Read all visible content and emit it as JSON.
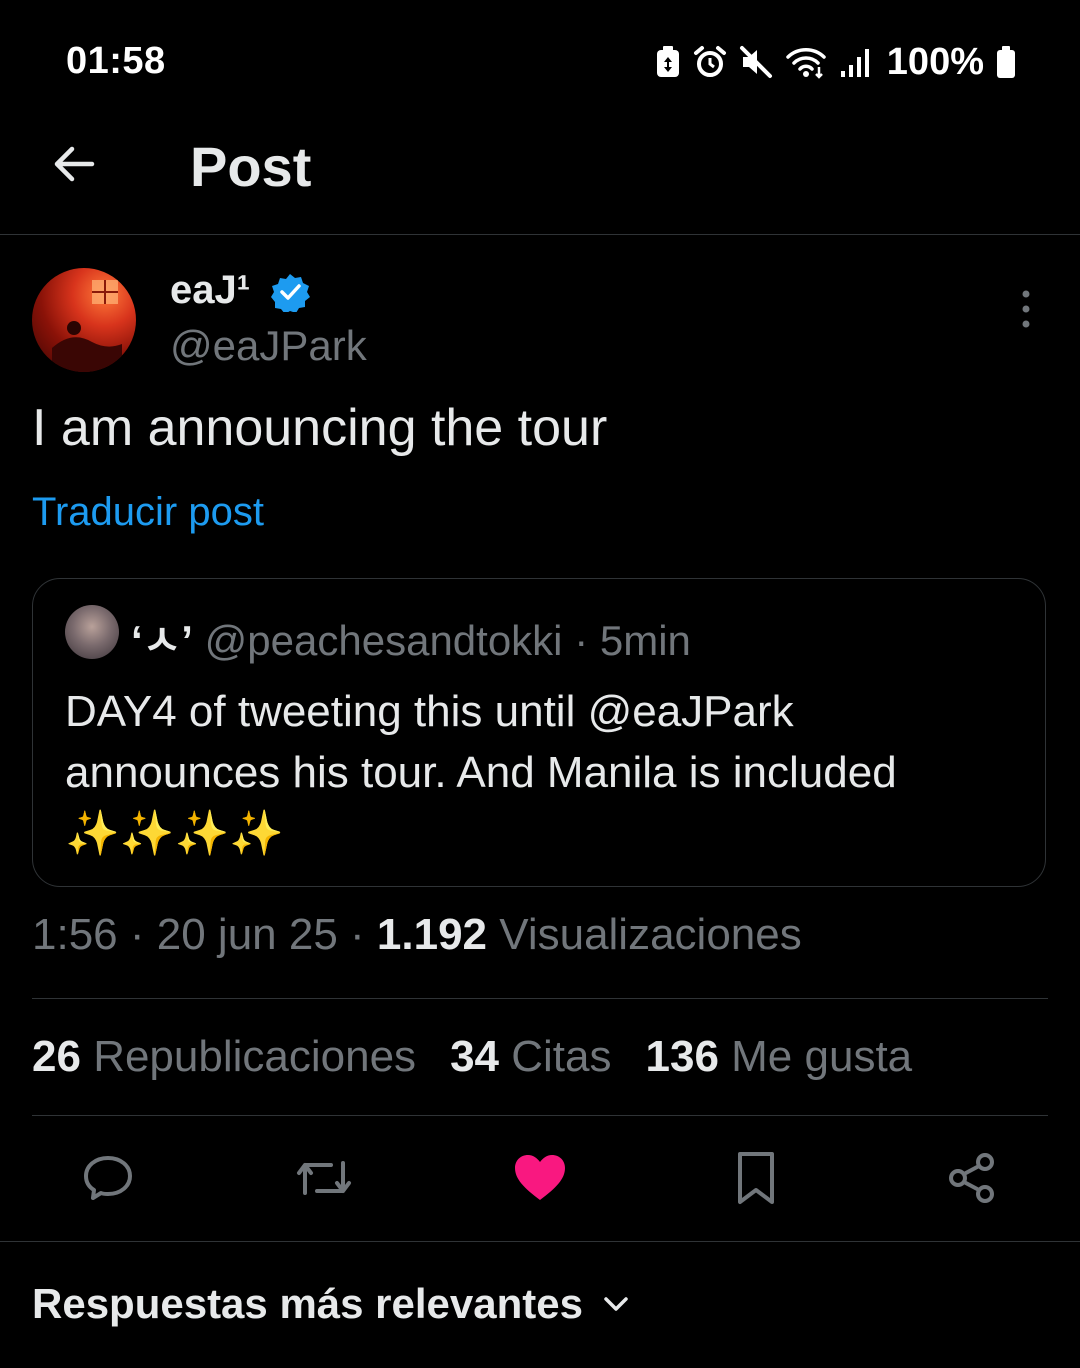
{
  "status_bar": {
    "time": "01:58",
    "battery": "100%",
    "icons": [
      "battery-saver-icon",
      "alarm-icon",
      "mute-icon",
      "wifi-icon",
      "signal-icon",
      "battery-icon"
    ]
  },
  "header": {
    "title": "Post",
    "back_icon": "arrow-left-icon"
  },
  "post": {
    "author_name": "eaJ¹",
    "author_handle": "@eaJPark",
    "verified": true,
    "text": "I am announcing the tour",
    "translate_label": "Traducir post",
    "quote": {
      "name": "‘ㅅ’",
      "handle": "@peachesandtokki",
      "time": "· 5min",
      "text": "DAY4 of tweeting this until @eaJPark announces his tour. And Manila is included ✨✨✨✨"
    },
    "meta": {
      "time": "1:56",
      "date": "· 20 jun 25 ·",
      "views_count": "1.192",
      "views_label": "Visualizaciones"
    },
    "stats": {
      "reposts_count": "26",
      "reposts_label": "Republicaciones",
      "quotes_count": "34",
      "quotes_label": "Citas",
      "likes_count": "136",
      "likes_label": "Me gusta"
    },
    "actions": [
      "reply-icon",
      "repost-icon",
      "heart-icon",
      "bookmark-icon",
      "share-icon"
    ],
    "liked": true
  },
  "replies": {
    "sort_label": "Respuestas más relevantes"
  },
  "colors": {
    "background": "#000000",
    "accent": "#1d9bf0",
    "like": "#f91880",
    "secondary_text": "#71767b"
  }
}
